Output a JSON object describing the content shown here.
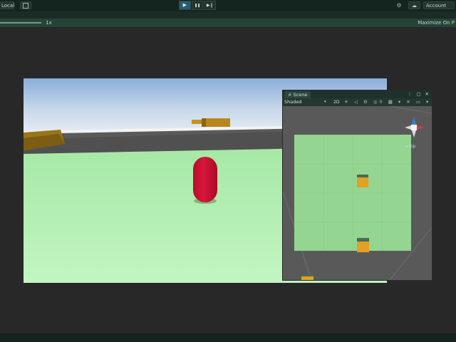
{
  "toolbar": {
    "pivot_rotation": "Local",
    "grid_icon": "grid-snap-icon",
    "play_icon": "▶",
    "pause_icon": "❚❚",
    "step_icon": "▶❙",
    "collab_icon": "collab-icon",
    "cloud_icon": "cloud-icon",
    "account_label": "Account",
    "account_arrow": "▾"
  },
  "game": {
    "scale_label": "1x",
    "maximize_label": "Maximize On P"
  },
  "scene": {
    "tab_label": "Scene",
    "tab_icon": "scene-grid-icon",
    "window_controls": "⋮ ▢ ✕",
    "shading_mode": "Shaded",
    "shading_arrow": "▾",
    "mode_2d": "2D",
    "toolbar_icons": "☀ ◁ ⚙ ◎0 ▦ ▾ ✕ ▭ ▾",
    "gizmo_label": "Top"
  },
  "colors": {
    "toolbar_bg": "#14241f",
    "subbar_bg": "#264338",
    "ground_green": "#b6f0b6",
    "capsule_red": "#c41133",
    "cube_orange": "#e3a022",
    "scene_plane": "#93d591"
  }
}
